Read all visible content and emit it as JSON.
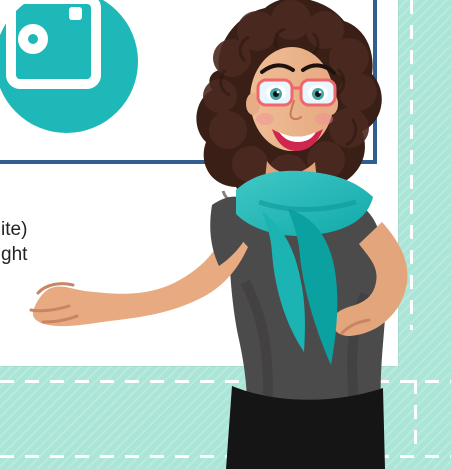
{
  "visible_text": {
    "line_1": "ite)",
    "line_2": "ght"
  },
  "graphics": {
    "header_icon": "instagram-icon",
    "character": "woman-with-teal-scarf",
    "accent_color": "#1fb8b8",
    "frame_color": "#abe5d8",
    "divider_color": "#335e91"
  }
}
